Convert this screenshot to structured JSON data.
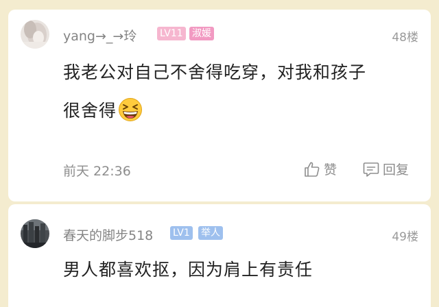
{
  "comments": [
    {
      "username": "yang→_→玲",
      "level": "LV11",
      "title": "淑媛",
      "floor": "48楼",
      "content_line1": "我老公对自己不舍得吃穿，对我和孩子",
      "content_line2": "很舍得",
      "emoji": "grinning-squinting-face",
      "time": "前天 22:36",
      "like_label": "赞",
      "reply_label": "回复"
    },
    {
      "username": "春天的脚步518",
      "level": "LV1",
      "title": "举人",
      "floor": "49楼",
      "content_line1": "男人都喜欢抠，因为肩上有责任"
    }
  ],
  "colors": {
    "background": "#f4eccf",
    "card": "#ffffff",
    "username": "#848484",
    "content": "#222222",
    "meta": "#8d8d8d",
    "badge_pink_level": "#f6b6cf",
    "badge_pink_title": "#f29ac2",
    "badge_blue": "#9ec0ee"
  }
}
